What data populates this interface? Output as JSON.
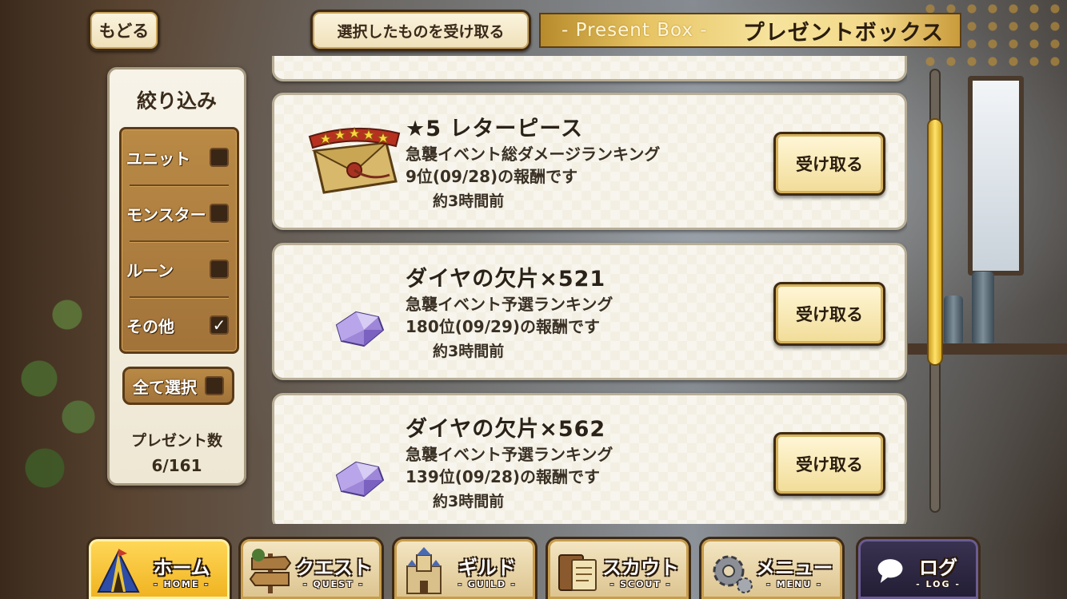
{
  "header": {
    "back_label": "もどる",
    "receive_selected_label": "選択したものを受け取る",
    "title_sub": "- Present Box -",
    "title_main": "プレゼントボックス"
  },
  "filter": {
    "title": "絞り込み",
    "items": [
      {
        "label": "ユニット",
        "checked": false,
        "mark": ""
      },
      {
        "label": "モンスター",
        "checked": false,
        "mark": ""
      },
      {
        "label": "ルーン",
        "checked": false,
        "mark": ""
      },
      {
        "label": "その他",
        "checked": true,
        "mark": "✓"
      }
    ],
    "select_all_label": "全て選択",
    "select_all_mark": "",
    "present_count_label": "プレゼント数",
    "present_count_value": "6/161"
  },
  "presents": [
    {
      "icon": "letter-piece-icon",
      "name": "★5 レターピース",
      "desc1": "急襲イベント総ダメージランキング",
      "desc2": "9位(09/28)の報酬です",
      "time": "約3時間前",
      "button": "受け取る"
    },
    {
      "icon": "diamond-shard-icon",
      "name": "ダイヤの欠片×521",
      "desc1": "急襲イベント予選ランキング",
      "desc2": "180位(09/29)の報酬です",
      "time": "約3時間前",
      "button": "受け取る"
    },
    {
      "icon": "diamond-shard-icon",
      "name": "ダイヤの欠片×562",
      "desc1": "急襲イベント予選ランキング",
      "desc2": "139位(09/28)の報酬です",
      "time": "約3時間前",
      "button": "受け取る"
    }
  ],
  "nav": [
    {
      "label": "ホーム",
      "sub": "- HOME -",
      "icon": "tent-icon",
      "active": true
    },
    {
      "label": "クエスト",
      "sub": "- QUEST -",
      "icon": "signpost-icon",
      "active": false
    },
    {
      "label": "ギルド",
      "sub": "- GUILD -",
      "icon": "castle-icon",
      "active": false
    },
    {
      "label": "スカウト",
      "sub": "- SCOUT -",
      "icon": "scroll-book-icon",
      "active": false
    },
    {
      "label": "メニュー",
      "sub": "- MENU -",
      "icon": "gear-icon",
      "active": false
    },
    {
      "label": "ログ",
      "sub": "- LOG -",
      "icon": "chat-bubble-icon",
      "active": false
    }
  ],
  "colors": {
    "accent_gold": "#f0b21f",
    "wood": "#a2733a",
    "parchment": "#f3efe3",
    "text_dark": "#2a2218"
  }
}
